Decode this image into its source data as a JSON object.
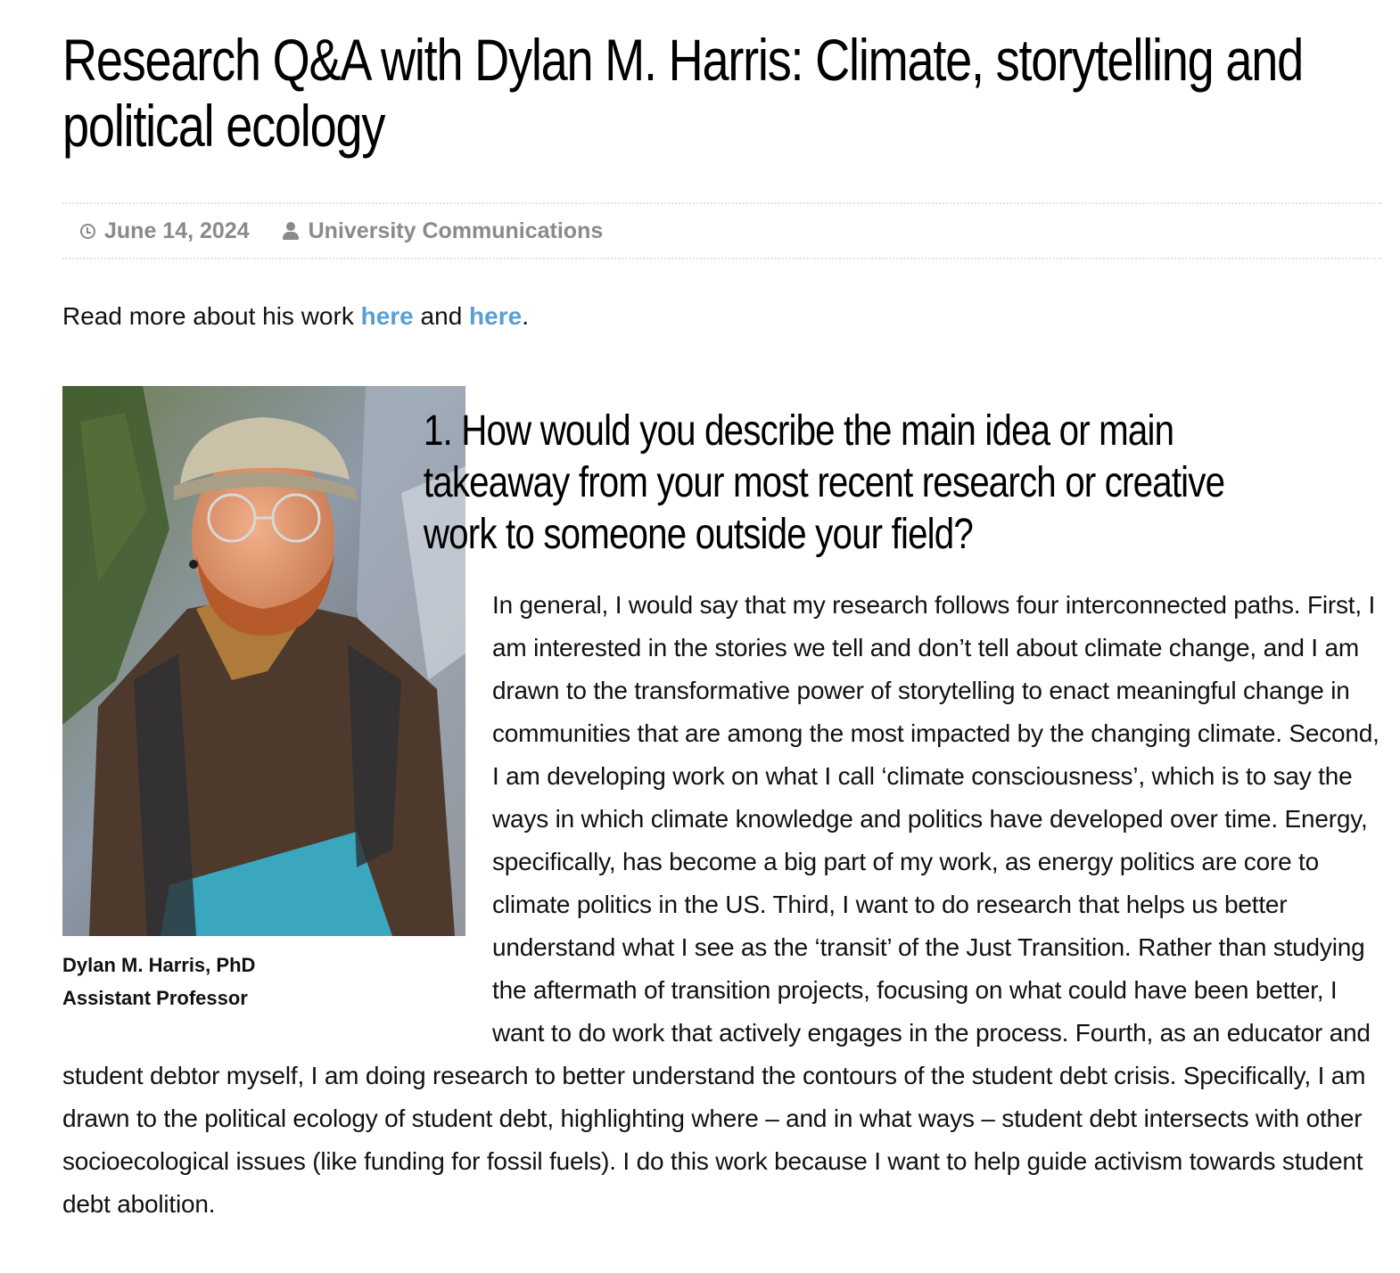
{
  "article": {
    "title": "Research Q&A with Dylan M. Harris: Climate, storytelling and political ecology",
    "meta": {
      "date": "June 14, 2024",
      "author": "University Communications",
      "date_icon": "clock-icon",
      "author_icon": "user-icon"
    },
    "intro": {
      "prefix": "Read more about his work ",
      "link1": "here",
      "middle": " and ",
      "link2": "here",
      "suffix": "."
    },
    "photo": {
      "caption_name": "Dylan M. Harris, PhD",
      "caption_title": "Assistant Professor"
    },
    "question": {
      "line1": "1. How would you describe the main idea or main",
      "line2": "takeaway from your most recent research or creative",
      "line3": "work to someone outside your field?"
    },
    "answer": "In general, I would say that my research follows four interconnected paths. First, I am interested in the stories we tell and don’t tell about climate change, and I am drawn to the transformative power of storytelling to enact meaningful change in communities that are among the most impacted by the changing climate. Second, I am developing work on what I call ‘climate consciousness’, which is to say the ways in which climate knowledge and politics have developed over time. Energy, specifically, has become a big part of my work, as energy politics are core to climate politics in the US. Third, I want to do research that helps us better understand what I see as the ‘transit’ of the Just Transition. Rather than studying the aftermath of transition projects, focusing on what could have been better, I want to do work that actively engages in the process. Fourth, as an educator and student debtor myself, I am doing research to better understand the contours of the student debt crisis. Specifically, I am drawn to the political ecology of student debt, highlighting where – and in what ways – student debt intersects with other socioecological issues (like funding for fossil fuels). I do this work because I want to help guide activism towards student debt abolition."
  }
}
